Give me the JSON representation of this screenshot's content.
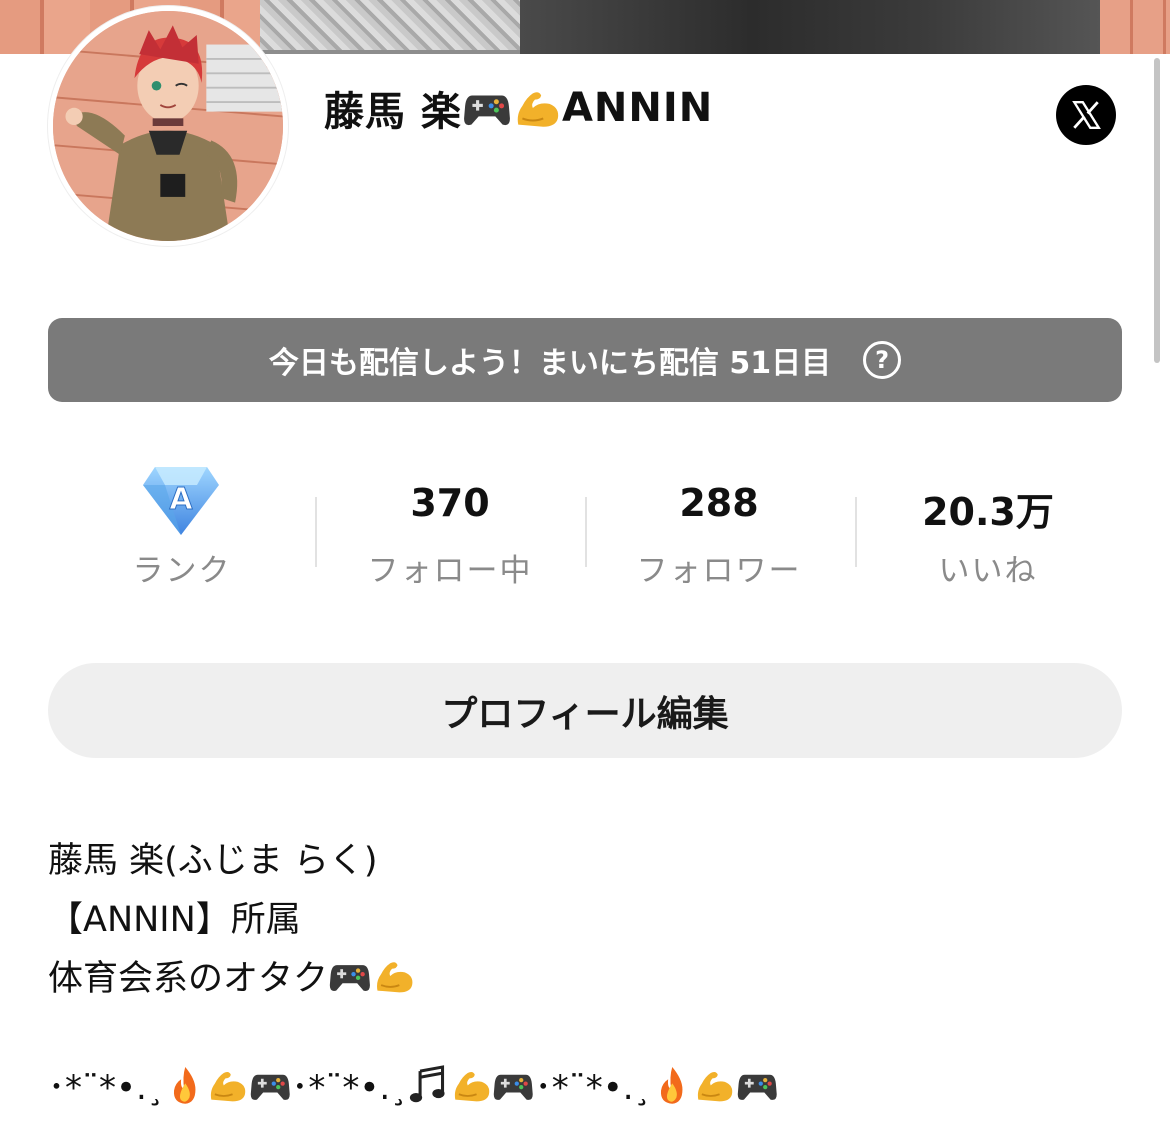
{
  "profile": {
    "name": "藤馬 楽",
    "name_suffix": "ANNIN",
    "name_emojis": [
      "game-controller-icon",
      "flexed-biceps-icon"
    ]
  },
  "social": {
    "x_icon": "x-logo-icon"
  },
  "streak": {
    "text": "今日も配信しよう！まいにち配信 51日目",
    "help_icon": "question-circle-icon",
    "help_glyph": "?"
  },
  "stats": {
    "rank_letter": "A",
    "rank_label": "ランク",
    "following_value": "370",
    "following_label": "フォロー中",
    "followers_value": "288",
    "followers_label": "フォロワー",
    "likes_value": "20.3万",
    "likes_label": "いいね"
  },
  "edit_profile_label": "プロフィール編集",
  "bio": {
    "line1": "藤馬 楽(ふじま らく)",
    "line2": "【ANNIN】所属",
    "line3": "体育会系のオタク",
    "deco_segment": "･*¨*•.¸"
  },
  "colors": {
    "streak_bg": "#7a7a7a",
    "button_bg": "#efefef",
    "label_gray": "#8a8a8a",
    "rank_blue": "#5aa6ea"
  }
}
